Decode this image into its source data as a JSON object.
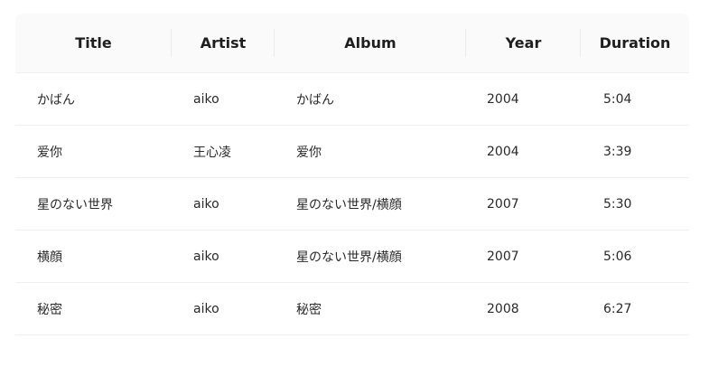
{
  "table": {
    "columns": [
      {
        "label": "Title"
      },
      {
        "label": "Artist"
      },
      {
        "label": "Album"
      },
      {
        "label": "Year"
      },
      {
        "label": "Duration"
      }
    ],
    "rows": [
      {
        "title": "かばん",
        "artist": "aiko",
        "album": "かばん",
        "year": "2004",
        "duration": "5:04"
      },
      {
        "title": "爱你",
        "artist": "王心凌",
        "album": "爱你",
        "year": "2004",
        "duration": "3:39"
      },
      {
        "title": "星のない世界",
        "artist": "aiko",
        "album": "星のない世界/横顔",
        "year": "2007",
        "duration": "5:30"
      },
      {
        "title": "横顔",
        "artist": "aiko",
        "album": "星のない世界/横顔",
        "year": "2007",
        "duration": "5:06"
      },
      {
        "title": "秘密",
        "artist": "aiko",
        "album": "秘密",
        "year": "2008",
        "duration": "6:27"
      }
    ]
  }
}
